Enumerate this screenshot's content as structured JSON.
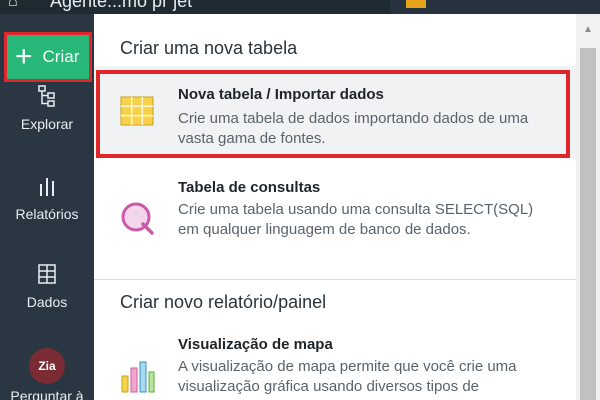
{
  "topbar": {
    "title": "Agente...mo pr jet"
  },
  "sidebar": {
    "create_label": "Criar",
    "items": [
      {
        "label": "Explorar"
      },
      {
        "label": "Relatórios"
      },
      {
        "label": "Dados"
      },
      {
        "label": "Perguntar à",
        "badge": "Zia"
      }
    ]
  },
  "menu": {
    "section1_title": "Criar uma nova tabela",
    "section2_title": "Criar novo relatório/painel",
    "items": [
      {
        "title": "Nova tabela / Importar dados",
        "description": "Crie uma tabela de dados importando dados de uma vasta gama de fontes.",
        "icon": "table-grid-icon"
      },
      {
        "title": "Tabela de consultas",
        "description": "Crie uma tabela usando uma consulta SELECT(SQL) em qualquer linguagem de banco de dados.",
        "icon": "query-table-icon"
      },
      {
        "title": "Visualização de mapa",
        "description": "A visualização de mapa permite que você crie uma visualização gráfica usando diversos tipos de",
        "icon": "chart-bars-icon"
      }
    ]
  },
  "colors": {
    "sidebar": "#2a3742",
    "accent_green": "#26b779",
    "highlight_red": "#e0262b"
  }
}
